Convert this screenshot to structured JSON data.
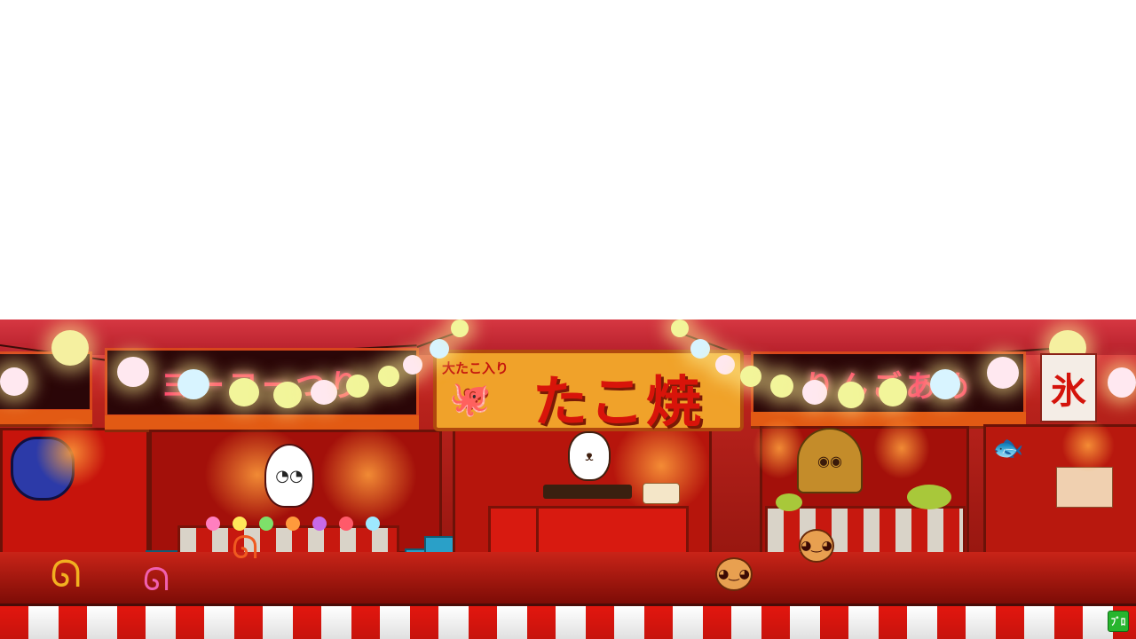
{
  "scene": {
    "left_sign_text": "ヨーヨーつり",
    "right_sign_text": "りんごあめ",
    "center_small_text": "大たこ入り",
    "center_big_text": "たこ焼",
    "side_banner_text": "氷",
    "badge_text": "ﾌﾞﾛ"
  },
  "colors": {
    "background_top": "#ffffff",
    "awning": "#d63742",
    "kohaku_red": "#e2160e",
    "kohaku_white": "#ffffff",
    "sign_orange": "#f0a22a",
    "badge_green": "#27b52e"
  },
  "icons": [
    "paper-lantern-icon",
    "octopus-icon",
    "balloon-dog-icon",
    "ghost-icon",
    "bear-vendor-icon",
    "monster-vendor-icon",
    "takoyaki-icon",
    "water-bucket-icon"
  ]
}
